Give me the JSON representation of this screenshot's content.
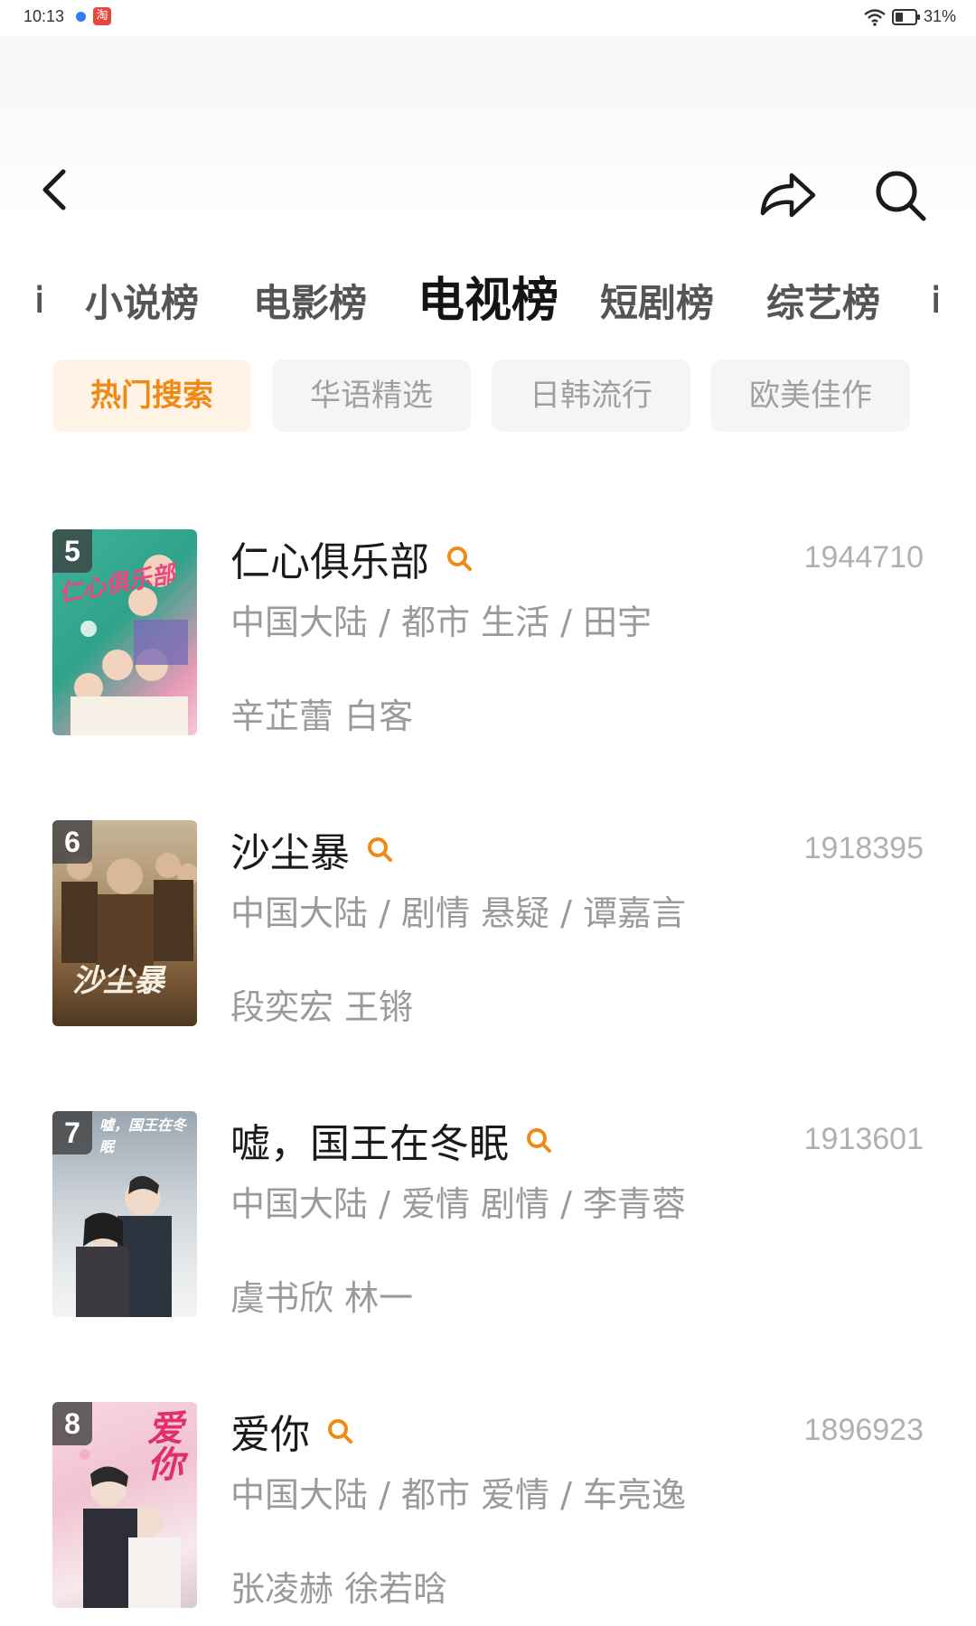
{
  "status_bar": {
    "time": "10:13",
    "app_badge": "淘",
    "battery": "31%"
  },
  "header": {
    "back_icon": "chevron-left-icon",
    "share_icon": "share-arrow-icon",
    "search_icon": "search-icon"
  },
  "tabs": [
    {
      "label": "小说榜",
      "active": false
    },
    {
      "label": "电影榜",
      "active": false
    },
    {
      "label": "电视榜",
      "active": true
    },
    {
      "label": "短剧榜",
      "active": false
    },
    {
      "label": "综艺榜",
      "active": false
    }
  ],
  "chips": [
    {
      "label": "热门搜索",
      "active": true
    },
    {
      "label": "华语精选",
      "active": false
    },
    {
      "label": "日韩流行",
      "active": false
    },
    {
      "label": "欧美佳作",
      "active": false
    }
  ],
  "items": [
    {
      "rank": "5",
      "title": "仁心俱乐部",
      "heat": "1944710",
      "meta": "中国大陆 / 都市 生活 / 田宇",
      "cast": "辛芷蕾 白客",
      "poster_text": "仁心俱乐部"
    },
    {
      "rank": "6",
      "title": "沙尘暴",
      "heat": "1918395",
      "meta": "中国大陆 / 剧情 悬疑 / 谭嘉言",
      "cast": "段奕宏 王锵",
      "poster_text": "沙尘暴"
    },
    {
      "rank": "7",
      "title": "嘘，国王在冬眠",
      "heat": "1913601",
      "meta": "中国大陆 / 爱情 剧情 / 李青蓉",
      "cast": "虞书欣 林一",
      "poster_text": "嘘，国王在冬眠"
    },
    {
      "rank": "8",
      "title": "爱你",
      "heat": "1896923",
      "meta": "中国大陆 / 都市 爱情 / 车亮逸",
      "cast": "张凌赫 徐若晗",
      "poster_text": "爱你"
    }
  ],
  "colors": {
    "accent": "#f08a16",
    "chip_active_bg": "#fff3e5",
    "text_muted": "#9a9a9a",
    "heat": "#b0b0b0"
  }
}
